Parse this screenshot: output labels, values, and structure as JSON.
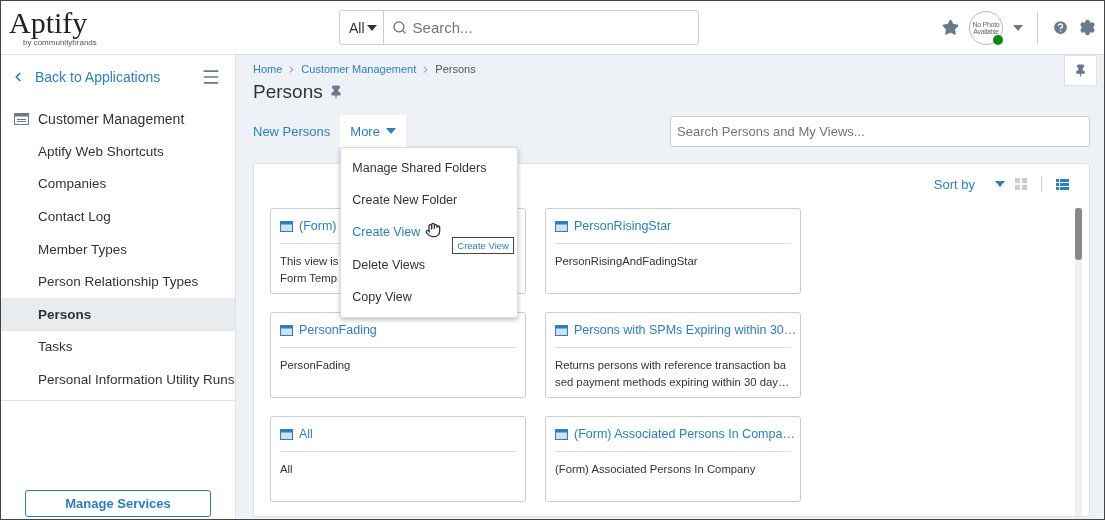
{
  "header": {
    "logo": {
      "name": "Aptify",
      "tagline": "by communitybrands"
    },
    "search": {
      "scope": "All",
      "placeholder": "Search..."
    },
    "avatar": {
      "text": "No Photo Available",
      "online": true
    }
  },
  "sidebar": {
    "back": "Back to Applications",
    "section": "Customer Management",
    "items": [
      {
        "label": "Aptify Web Shortcuts",
        "selected": false
      },
      {
        "label": "Companies",
        "selected": false
      },
      {
        "label": "Contact Log",
        "selected": false
      },
      {
        "label": "Member Types",
        "selected": false
      },
      {
        "label": "Person Relationship Types",
        "selected": false
      },
      {
        "label": "Persons",
        "selected": true
      },
      {
        "label": "Tasks",
        "selected": false
      },
      {
        "label": "Personal Information Utility Runs",
        "selected": false
      }
    ],
    "button": "Manage Services"
  },
  "main": {
    "breadcrumb": [
      "Home",
      "Customer Management",
      "Persons"
    ],
    "title": "Persons",
    "new_link": "New Persons",
    "more": {
      "label": "More",
      "expanded": true,
      "items": [
        {
          "label": "Manage Shared Folders",
          "hovered": false
        },
        {
          "label": "Create New Folder",
          "hovered": false
        },
        {
          "label": "Create View",
          "hovered": true
        },
        {
          "label": "Delete Views",
          "hovered": false
        },
        {
          "label": "Copy View",
          "hovered": false
        }
      ],
      "tooltip": "Create View"
    },
    "search_placeholder": "Search Persons and My Views...",
    "sort": "Sort by",
    "view": {
      "grid_selected": false,
      "list_selected": true
    },
    "cards": [
      {
        "title": "(Form)",
        "body": [
          "This view is",
          "Form Temp"
        ]
      },
      {
        "title": "PersonRisingStar",
        "body": [
          "PersonRisingAndFadingStar"
        ]
      },
      {
        "title": "PersonFading",
        "body": [
          "PersonFading"
        ]
      },
      {
        "title": "Persons with SPMs Expiring within 30…",
        "body": [
          "Returns persons with reference transaction ba",
          "sed payment methods expiring within 30 day…"
        ]
      },
      {
        "title": "All",
        "body": [
          "All"
        ]
      },
      {
        "title": "(Form) Associated Persons In Compa…",
        "body": [
          "(Form) Associated Persons In Company"
        ]
      }
    ]
  }
}
